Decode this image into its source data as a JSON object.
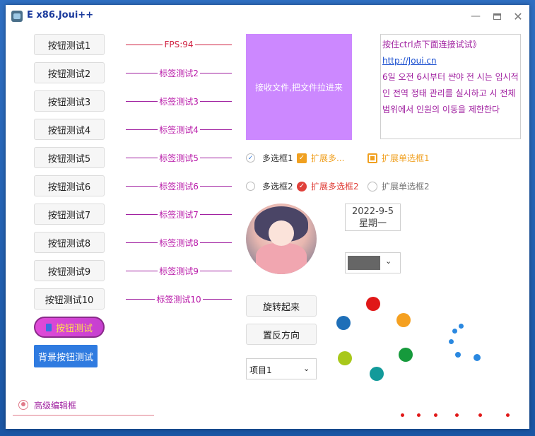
{
  "window": {
    "title": "E x86.Joui++"
  },
  "buttons": [
    "按钮测试1",
    "按钮测试2",
    "按钮测试3",
    "按钮测试4",
    "按钮测试5",
    "按钮测试6",
    "按钮测试7",
    "按钮测试8",
    "按钮测试9",
    "按钮测试10"
  ],
  "labels": [
    "FPS:94",
    "标签测试2",
    "标签测试3",
    "标签测试4",
    "标签测试5",
    "标签测试6",
    "标签测试7",
    "标签测试8",
    "标签测试9",
    "标签测试10"
  ],
  "dropzone": {
    "text": "接收文件,把文件拉进来"
  },
  "richtext": {
    "line1": "按住ctrl点下面连接试试》",
    "link": "http://Joui.cn",
    "body": "6일 오전 6시부터 쌴야 전 시는 임시적인 전역 정태 관리를 실시하고 시 전체 범위에서 인원의 이동을 제한한다"
  },
  "checkboxes": {
    "cb1": "多选框1",
    "cb2": "多选框2",
    "ext_cb1": "扩展多...",
    "ext_cb2": "扩展多选框2",
    "ext_radio1": "扩展单选框1",
    "ext_radio2": "扩展单选框2"
  },
  "date": {
    "date": "2022-9-5",
    "weekday": "星期一"
  },
  "colorpicker": {
    "color": "#666666"
  },
  "actions": {
    "rotate": "旋转起来",
    "reverse": "置反方向"
  },
  "combo": {
    "value": "项目1"
  },
  "pill_button": {
    "label": "按钮测试"
  },
  "bg_button": {
    "label": "背景按钮测试"
  },
  "advanced_edit": {
    "label": "高级编辑框"
  },
  "colors": {
    "purple": "#cc88ff",
    "orange": "#f0a020",
    "red": "#e0403a",
    "blue": "#2f7be0"
  }
}
